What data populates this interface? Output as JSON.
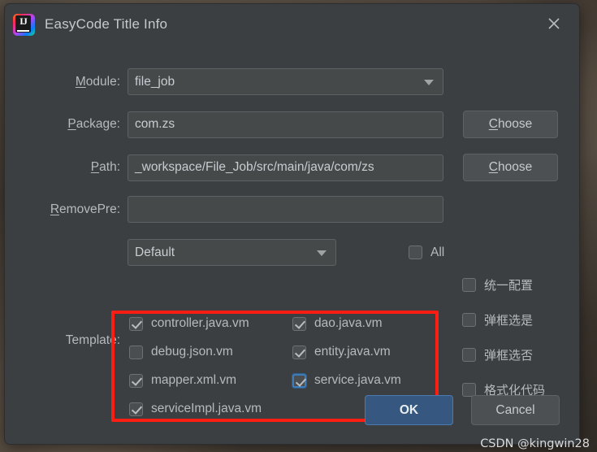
{
  "window": {
    "title": "EasyCode Title Info",
    "app_icon": "intellij-idea-icon",
    "close_icon": "close-icon"
  },
  "form": {
    "module": {
      "label": "Module:",
      "mnemonic": "M",
      "value": "file_job",
      "control": "combobox",
      "arrow_icon": "chevron-down-icon"
    },
    "package": {
      "label": "Package:",
      "mnemonic": "P",
      "value": "com.zs",
      "choose_label": "Choose",
      "choose_mnemonic": "C"
    },
    "path": {
      "label": "Path:",
      "mnemonic": "P",
      "value": "_workspace/File_Job/src/main/java/com/zs",
      "choose_label": "Choose",
      "choose_mnemonic": "C"
    },
    "remove_pre": {
      "label": "RemovePre:",
      "mnemonic": "R",
      "value": "",
      "placeholder": ""
    },
    "group": {
      "value": "Default",
      "control": "combobox",
      "arrow_icon": "chevron-down-icon"
    },
    "all": {
      "label": "All",
      "checked": false
    },
    "template": {
      "label": "Template:",
      "items": [
        {
          "label": "controller.java.vm",
          "checked": true,
          "focused": false
        },
        {
          "label": "dao.java.vm",
          "checked": true,
          "focused": false
        },
        {
          "label": "debug.json.vm",
          "checked": false,
          "focused": false
        },
        {
          "label": "entity.java.vm",
          "checked": true,
          "focused": false
        },
        {
          "label": "mapper.xml.vm",
          "checked": true,
          "focused": false
        },
        {
          "label": "service.java.vm",
          "checked": true,
          "focused": true
        },
        {
          "label": "serviceImpl.java.vm",
          "checked": true,
          "focused": false
        }
      ]
    },
    "options": [
      {
        "label": "统一配置",
        "checked": false
      },
      {
        "label": "弹框选是",
        "checked": false
      },
      {
        "label": "弹框选否",
        "checked": false
      },
      {
        "label": "格式化代码",
        "checked": false
      }
    ]
  },
  "footer": {
    "ok_label": "OK",
    "cancel_label": "Cancel"
  },
  "watermark": "CSDN @kingwin28",
  "colors": {
    "dialog_bg": "#3c3f41",
    "field_bg": "#45494a",
    "accent_primary": "#365880",
    "annotation_red": "#fe1d12",
    "focus_blue": "#3f7cb7"
  }
}
